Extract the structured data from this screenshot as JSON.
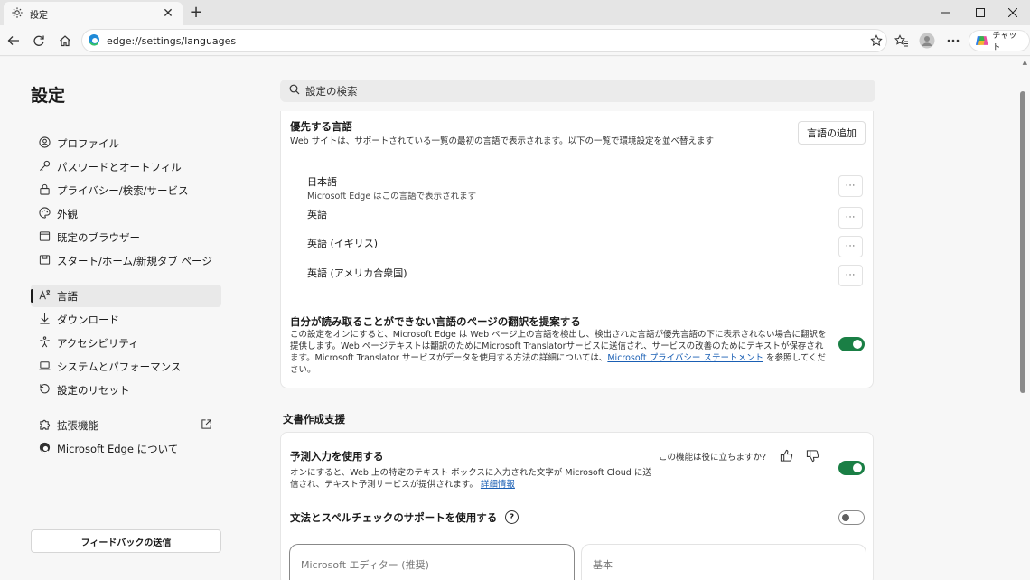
{
  "browser": {
    "tab_title": "設定",
    "url": "edge://settings/languages",
    "chat_label": "チャット"
  },
  "sidebar": {
    "title": "設定",
    "items": [
      {
        "label": "プロファイル",
        "icon": "profile-icon"
      },
      {
        "label": "パスワードとオートフィル",
        "icon": "key-icon"
      },
      {
        "label": "プライバシー/検索/サービス",
        "icon": "lock-icon"
      },
      {
        "label": "外観",
        "icon": "palette-icon"
      },
      {
        "label": "既定のブラウザー",
        "icon": "browser-window-icon"
      },
      {
        "label": "スタート/ホーム/新規タブ ページ",
        "icon": "home-window-icon"
      },
      {
        "label": "言語",
        "icon": "language-icon",
        "active": true
      },
      {
        "label": "ダウンロード",
        "icon": "download-icon"
      },
      {
        "label": "アクセシビリティ",
        "icon": "accessibility-icon"
      },
      {
        "label": "システムとパフォーマンス",
        "icon": "laptop-icon"
      },
      {
        "label": "設定のリセット",
        "icon": "reset-icon"
      },
      {
        "label": "拡張機能",
        "icon": "puzzle-icon"
      },
      {
        "label": "Microsoft Edge について",
        "icon": "edge-logo-icon"
      }
    ],
    "feedback_label": "フィードバックの送信"
  },
  "search": {
    "placeholder": "設定の検索"
  },
  "preferred_languages": {
    "title": "優先する言語",
    "description": "Web サイトは、サポートされている一覧の最初の言語で表示されます。以下の一覧で環境設定を並べ替えます",
    "add_label": "言語の追加",
    "languages": [
      {
        "name": "日本語",
        "sub": "Microsoft Edge はこの言語で表示されます"
      },
      {
        "name": "英語",
        "sub": ""
      },
      {
        "name": "英語 (イギリス)",
        "sub": ""
      },
      {
        "name": "英語 (アメリカ合衆国)",
        "sub": ""
      }
    ],
    "more_label": "···"
  },
  "translate": {
    "title": "自分が読み取ることができない言語のページの翻訳を提案する",
    "description": "この設定をオンにすると、Microsoft Edge は Web ページ上の言語を検出し、検出された言語が優先言語の下に表示されない場合に翻訳を提供します。Web ページテキストは翻訳のためにMicrosoft Translatorサービスに送信され、サービスの改善のためにテキストが保存されます。Microsoft Translator サービスがデータを使用する方法の詳細については、",
    "link": "Microsoft プライバシー ステートメント",
    "suffix": " を参照してください。",
    "enabled": true
  },
  "writing_assist": {
    "heading": "文書作成支援",
    "predict_title": "予測入力を使用する",
    "predict_desc": "オンにすると、Web 上の特定のテキスト ボックスに入力された文字が Microsoft Cloud に送信され、テキスト予測サービスが提供されます。",
    "predict_link": "詳細情報",
    "predict_enabled": true,
    "feedback_question": "この機能は役に立ちますか?",
    "grammar_title": "文法とスペルチェックのサポートを使用する",
    "grammar_help": "?",
    "grammar_enabled": false,
    "choice_a": "Microsoft エディター (推奨)",
    "choice_b": "基本"
  },
  "colors": {
    "accent_green": "#1a7f45",
    "link_blue": "#1a5fb4"
  }
}
